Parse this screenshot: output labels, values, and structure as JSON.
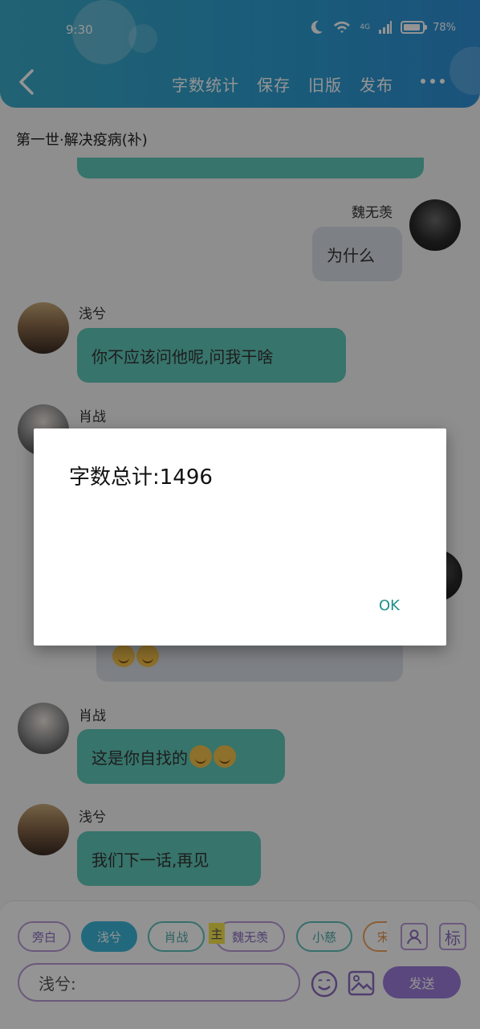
{
  "status": {
    "time": "9:30",
    "network": "4G",
    "battery": "78%"
  },
  "header": {
    "actions": [
      "字数统计",
      "保存",
      "旧版",
      "发布"
    ]
  },
  "chapter_title": "第一世·解决疫病(补)",
  "messages": [
    {
      "side": "right",
      "name": "魏无羡",
      "text": "为什么"
    },
    {
      "side": "left",
      "name": "浅兮",
      "text": "你不应该问他呢,问我干啥"
    },
    {
      "side": "left",
      "name": "肖战",
      "text": ""
    },
    {
      "side": "left",
      "name": "肖战",
      "text": "这是你自找的"
    },
    {
      "side": "left",
      "name": "浅兮",
      "text": "我们下一话,再见"
    }
  ],
  "composer": {
    "chips": [
      "旁白",
      "浅兮",
      "肖战",
      "魏无羡",
      "小慈",
      "宋"
    ],
    "main_badge": "主",
    "input_value": "浅兮:",
    "send_label": "发送",
    "mark_label": "标"
  },
  "dialog": {
    "message": "字数总计:1496",
    "ok_label": "OK"
  },
  "colors": {
    "header": "#2e9fd0",
    "teal_bubble": "#5fc9b9",
    "gray_bubble": "#d7dde3",
    "accent_purple": "#9b7bd8"
  }
}
